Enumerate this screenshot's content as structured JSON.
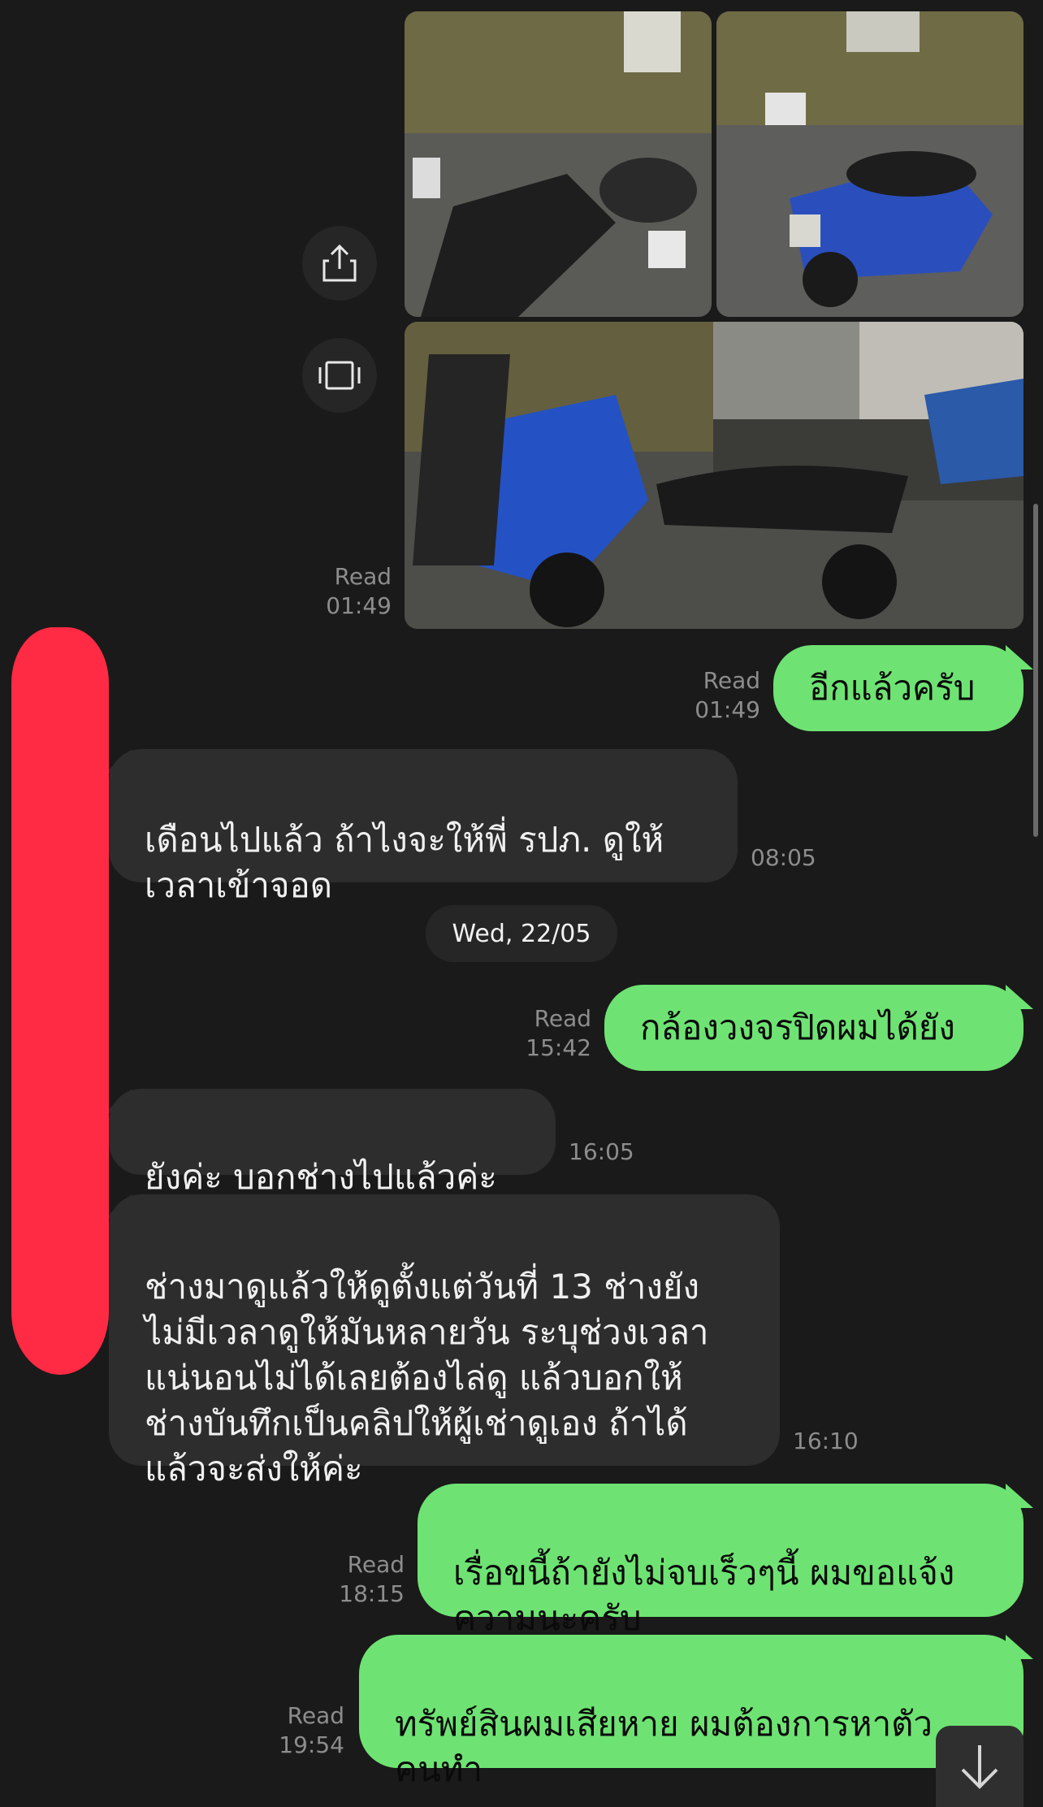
{
  "chat": {
    "messages": [
      {
        "id": "m1",
        "dir": "out",
        "type": "photos",
        "read": "Read",
        "time": "01:49"
      },
      {
        "id": "m2",
        "dir": "out",
        "text": "อีกแล้วครับ",
        "read": "Read",
        "time": "01:49"
      },
      {
        "id": "m3",
        "dir": "in",
        "text": "เดือนไปแล้ว ถ้าไงจะให้พี่ รปภ. ดูให้\nเวลาเข้าจอด",
        "time": "08:05"
      },
      {
        "id": "m4",
        "dir": "out",
        "text": "กล้องวงจรปิดผมได้ยัง",
        "read": "Read",
        "time": "15:42"
      },
      {
        "id": "m5",
        "dir": "in",
        "text": "ยังค่ะ บอกช่างไปแล้วค่ะ",
        "time": "16:05"
      },
      {
        "id": "m6",
        "dir": "in",
        "text": "ช่างมาดูแล้วให้ดูตั้งแต่วันที่ 13 ช่างยัง\nไม่มีเวลาดูให้มันหลายวัน ระบุช่วงเวลา\nแน่นอนไม่ได้เลยต้องไล่ดู แล้วบอกให้\nช่างบันทึกเป็นคลิปให้ผู้เช่าดูเอง ถ้าได้\nแล้วจะส่งให้ค่ะ",
        "time": "16:10"
      },
      {
        "id": "m7",
        "dir": "out",
        "text": "เรื่อขนี้ถ้ายังไม่จบเร็วๆนี้ ผมขอแจ้ง\nความนะครับ",
        "read": "Read",
        "time": "18:15"
      },
      {
        "id": "m8",
        "dir": "out",
        "text": "ทรัพย์สินผมเสียหาย ผมต้องการหาตัว\nคนทำ",
        "read": "Read",
        "time": "19:54"
      }
    ],
    "date_separator": "Wed, 22/05"
  },
  "icons": {
    "share": "share-icon",
    "gallery": "gallery-icon",
    "scroll_down": "arrow-down-icon"
  },
  "colors": {
    "background": "#1a1a1a",
    "outgoing_bubble": "#6ee373",
    "incoming_bubble": "#2d2d2d",
    "meta_text": "#8d8d8d",
    "redaction": "#ff2a44"
  }
}
